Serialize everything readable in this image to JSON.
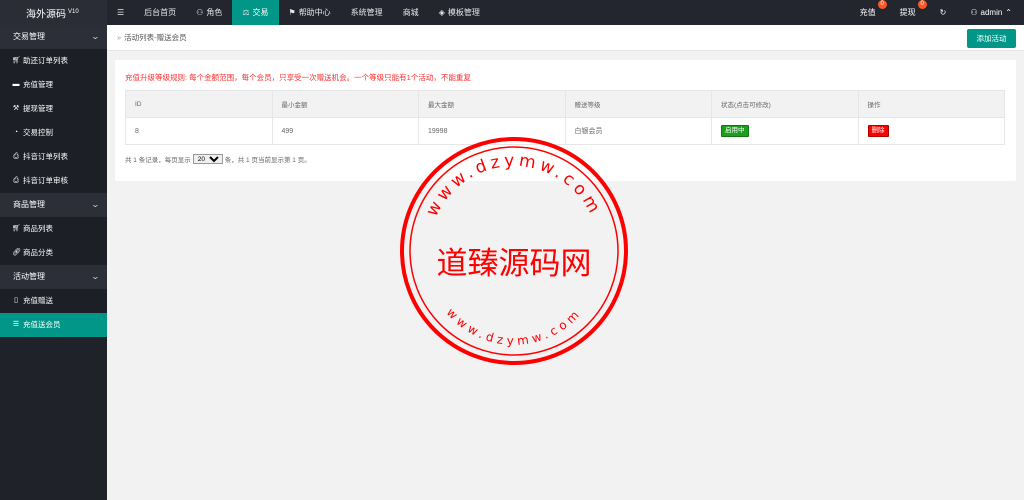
{
  "app": {
    "title": "海外源码",
    "version": "V10"
  },
  "topnav": {
    "items": [
      {
        "label": "",
        "icon": "menu-icon"
      },
      {
        "label": "后台首页",
        "icon": ""
      },
      {
        "label": "角色",
        "icon": "user-icon"
      },
      {
        "label": "交易",
        "icon": "scale-icon"
      },
      {
        "label": "帮助中心",
        "icon": "flag-icon"
      },
      {
        "label": "系统管理",
        "icon": ""
      },
      {
        "label": "商城",
        "icon": ""
      },
      {
        "label": "模板管理",
        "icon": "layers-icon"
      }
    ],
    "active_index": 3,
    "recharge": {
      "label": "充值",
      "badge": "0"
    },
    "withdraw": {
      "label": "提现",
      "badge": "0"
    },
    "user": {
      "label": "admin"
    }
  },
  "sidebar": {
    "groups": [
      {
        "label": "交易管理",
        "items": [
          "助还订单列表",
          "充值管理",
          "提现管理",
          "交易控制",
          "抖音订单列表",
          "抖音订单审核"
        ]
      },
      {
        "label": "商品管理",
        "items": [
          "商品列表",
          "商品分类"
        ]
      },
      {
        "label": "活动管理",
        "items": [
          "充值赠送",
          "充值送会员"
        ]
      }
    ]
  },
  "breadcrumb": {
    "text": "活动列表-赠送会员"
  },
  "add_button": {
    "label": "添加活动"
  },
  "rule_text": "充值升级等级规则: 每个金额范围，每个会员，只享受一次赠送机会。一个等级只能有1个活动，不能重复",
  "table": {
    "headers": [
      "ID",
      "最小金额",
      "最大金额",
      "赠送等级",
      "状态(点击可修改)",
      "操作"
    ],
    "rows": [
      {
        "id": "8",
        "min": "499",
        "max": "19998",
        "level": "白银会员",
        "status": "启用中",
        "action": "删除"
      }
    ]
  },
  "pager": {
    "prefix": "共 1 条记录，每页显示",
    "per_page": "20",
    "suffix": "条，共 1 页当前显示第 1 页。"
  },
  "watermark": {
    "center": "道臻源码网",
    "ring_top": "www.dzymw.com",
    "ring_bottom": "www.dzymw.com"
  },
  "colors": {
    "accent": "#009688",
    "topbar": "#23262e",
    "sidebar": "#20222a",
    "stamp": "#ff0000",
    "badge": "#ff5722"
  }
}
